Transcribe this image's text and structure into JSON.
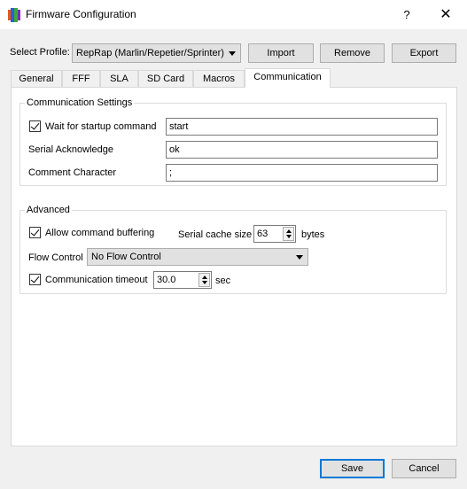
{
  "window": {
    "title": "Firmware Configuration",
    "help_label": "?",
    "close_label": "✕"
  },
  "profile": {
    "label": "Select Profile:",
    "selected": "RepRap (Marlin/Repetier/Sprinter)",
    "import_label": "Import",
    "remove_label": "Remove",
    "export_label": "Export"
  },
  "tabs": [
    {
      "label": "General"
    },
    {
      "label": "FFF"
    },
    {
      "label": "SLA"
    },
    {
      "label": "SD Card"
    },
    {
      "label": "Macros"
    },
    {
      "label": "Communication"
    }
  ],
  "active_tab": "Communication",
  "communication_settings": {
    "title": "Communication Settings",
    "wait_label": "Wait for startup command",
    "wait_checked": true,
    "wait_value": "start",
    "ack_label": "Serial Acknowledge",
    "ack_value": "ok",
    "comment_label": "Comment Character",
    "comment_value": ";"
  },
  "advanced": {
    "title": "Advanced",
    "buffering_label": "Allow command buffering",
    "buffering_checked": true,
    "cache_label": "Serial cache size",
    "cache_value": "63",
    "cache_unit": "bytes",
    "flow_label": "Flow Control",
    "flow_value": "No Flow Control",
    "timeout_label": "Communication timeout",
    "timeout_checked": true,
    "timeout_value": "30.0",
    "timeout_unit": "sec"
  },
  "footer": {
    "save_label": "Save",
    "cancel_label": "Cancel"
  },
  "colors": {
    "accent": "#0078d7",
    "window_bg": "#f0f0f0",
    "panel_bg": "#ffffff"
  }
}
